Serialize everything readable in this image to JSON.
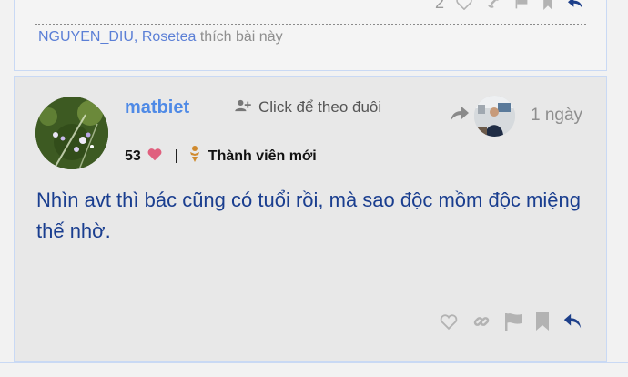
{
  "prev_post": {
    "like_count": "2",
    "likers": [
      "NGUYEN_DIU",
      "Rosetea"
    ],
    "likers_separator": ",",
    "likes_suffix": "thích bài này"
  },
  "post": {
    "username": "matbiet",
    "follow_label": "Click để theo đuôi",
    "time": "1 ngày",
    "heart_count": "53",
    "badge_label": "Thành viên mới",
    "content": "Nhìn avt thì bác cũng có tuổi rồi, mà sao độc mồm độc miệng thế nhờ."
  },
  "colors": {
    "username": "#4f8ae6",
    "content": "#1a3e8f",
    "heart": "#e0607e",
    "badge": "#d08a2e",
    "reply": "#1d3f8a",
    "icon_gray": "#b3b3b3",
    "card_border": "#c9d9f4"
  },
  "icons": [
    "heart-outline-icon",
    "link-icon",
    "flag-icon",
    "bookmark-icon",
    "reply-icon",
    "add-user-icon",
    "share-arrow-icon",
    "heart-icon",
    "badge-person-icon"
  ]
}
